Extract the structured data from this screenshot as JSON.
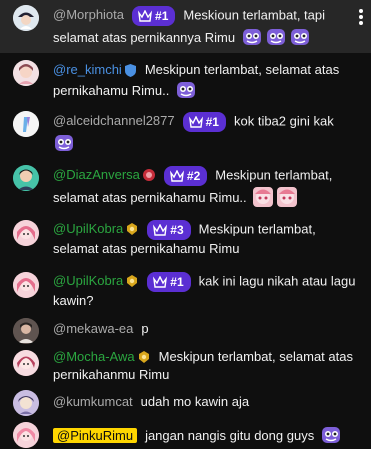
{
  "messages": [
    {
      "author": "@Morphiota",
      "style": "gray",
      "rank": "#1",
      "text": "Meskioun terlambat, tapi selamat atas pernikannya Rimu",
      "emojis": 3,
      "highlight": true
    },
    {
      "author": "@re_kimchi",
      "style": "blue",
      "verified": true,
      "text": "Meskipun terlambat, selamat atas pernikahamu Rimu..",
      "emojis": 1
    },
    {
      "author": "@alceidchannel2877",
      "style": "gray",
      "rank": "#1",
      "text": "kok tiba2 gini kak",
      "emojis": 1
    },
    {
      "author": "@DiazAnversa",
      "style": "green",
      "rank": "#2",
      "text": "Meskipun terlambat, selamat atas pernikahamu Rimu..",
      "emojis": 2,
      "emoji_kind": "pink"
    },
    {
      "author": "@UpilKobra",
      "style": "green",
      "rank": "#3",
      "text": "Meskipun terlambat, selamat atas pernikahamu Rimu"
    },
    {
      "author": "@UpilKobra",
      "style": "green",
      "rank": "#1",
      "text": "kak ini lagu nikah atau lagu kawin?"
    },
    {
      "author": "@mekawa-ea",
      "style": "gray",
      "text": "p"
    },
    {
      "author": "@Mocha-Awa",
      "style": "green",
      "text": "Meskipun terlambat, selamat atas pernikahanmu Rimu"
    },
    {
      "author": "@kumkumcat",
      "style": "gray",
      "text": "udah mo kawin aja"
    },
    {
      "author": "@PinkuRimu",
      "style": "pink",
      "text": "jangan nangis gitu dong guys",
      "emojis": 1
    }
  ],
  "icons": {
    "crown": "crown-icon",
    "verified": "verified-check-icon",
    "member": "member-badge-icon",
    "menu": "more-vert-icon"
  },
  "colors": {
    "background": "#0f0f0f",
    "highlight_row": "#272727",
    "rank_badge": "#5b2fd3",
    "moderator_blue": "#4a90e2",
    "member_green": "#2ba640",
    "owner_yellow": "#ffd600"
  }
}
